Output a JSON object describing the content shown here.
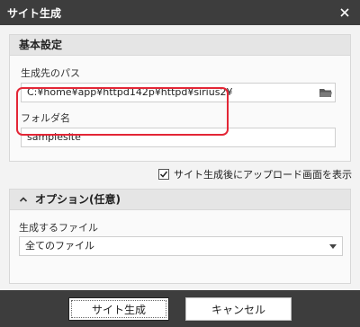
{
  "dialog": {
    "title": "サイト生成"
  },
  "basic_settings": {
    "header": "基本設定",
    "path_label": "生成先のパス",
    "path_value": "C:¥home¥app¥httpd142p¥httpd¥sirius2¥",
    "folder_label": "フォルダ名",
    "folder_value": "samplesite",
    "highlight_color": "#e32636"
  },
  "show_upload": {
    "label": "サイト生成後にアップロード画面を表示",
    "checked": true
  },
  "options": {
    "header": "オプション(任意)",
    "files_label": "生成するファイル",
    "files_selected": "全てのファイル"
  },
  "buttons": {
    "generate": "サイト生成",
    "cancel": "キャンセル"
  },
  "icons": {
    "close": "close-icon",
    "folder": "folder-icon",
    "collapse": "chevron-up-icon",
    "dropdown": "caret-down-icon",
    "check": "checkmark-icon"
  },
  "colors": {
    "titlebar": "#3d3d3d",
    "panel_header": "#e5e5e5",
    "highlight": "#e32636"
  }
}
